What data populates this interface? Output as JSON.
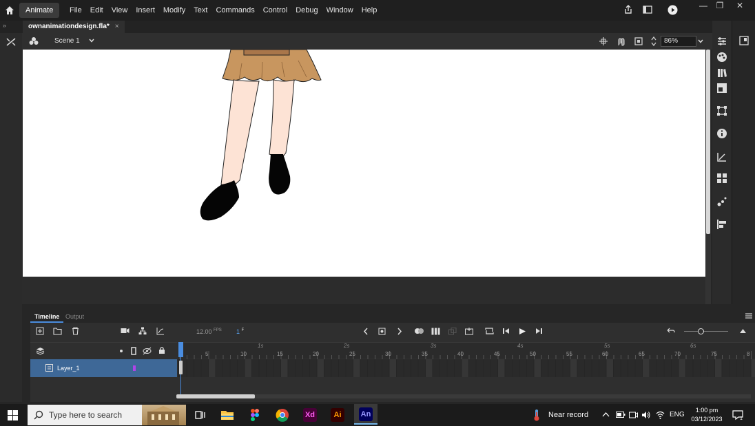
{
  "menubar": {
    "app_tab": "Animate",
    "menus": [
      "File",
      "Edit",
      "View",
      "Insert",
      "Modify",
      "Text",
      "Commands",
      "Control",
      "Debug",
      "Window",
      "Help"
    ],
    "window_buttons": [
      "—",
      "❐",
      "✕"
    ]
  },
  "document": {
    "tab_title": "ownanimationdesign.fla*",
    "close_glyph": "×"
  },
  "editbar": {
    "scene": "Scene 1",
    "zoom": "86%"
  },
  "timeline": {
    "tabs": [
      "Timeline",
      "Output"
    ],
    "fps": "12.00",
    "fps_unit": "FPS",
    "current_frame": "1",
    "frame_unit": "F",
    "layers": [
      {
        "name": "Layer_1"
      }
    ],
    "frame_ruler": [
      "5",
      "10",
      "15",
      "20",
      "25",
      "30",
      "35",
      "40",
      "45",
      "50",
      "55",
      "60",
      "65",
      "70",
      "75",
      "8"
    ],
    "second_ruler": [
      "1s",
      "2s",
      "3s",
      "4s",
      "5s",
      "6s"
    ]
  },
  "taskbar": {
    "search_placeholder": "Type here to search",
    "apps": [
      "file-explorer",
      "figma",
      "chrome",
      "xd",
      "illustrator",
      "animate"
    ],
    "app_labels": {
      "xd": "Xd",
      "ai": "Ai",
      "an": "An"
    },
    "weather": "Near record",
    "language": "ENG",
    "time": "1:00 pm",
    "date": "03/12/2023"
  },
  "colors": {
    "accent": "#4a8de0",
    "layer_selected": "#3e6897",
    "skirt": "#c8965f",
    "skin": "#fde3d5",
    "xd": "#470137",
    "ai": "#330000",
    "an": "#00005b"
  }
}
